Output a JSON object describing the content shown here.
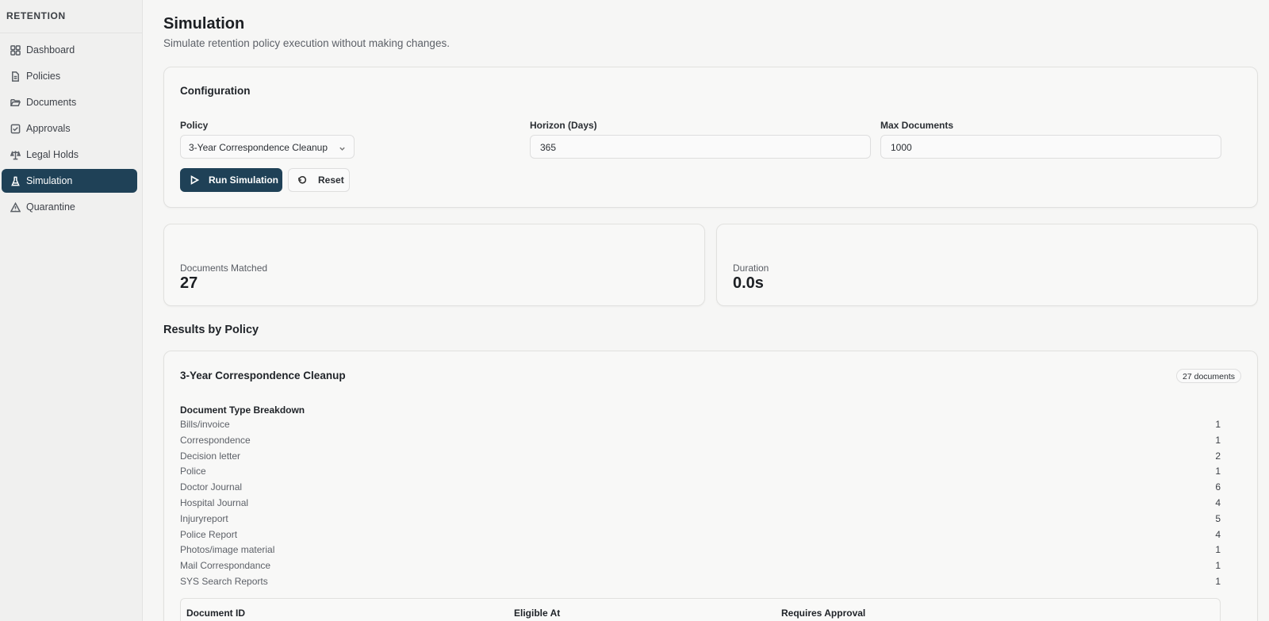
{
  "sidebar": {
    "brand": "RETENTION",
    "items": [
      {
        "label": "Dashboard",
        "icon": "grid-icon"
      },
      {
        "label": "Policies",
        "icon": "file-text-icon"
      },
      {
        "label": "Documents",
        "icon": "folder-open-icon"
      },
      {
        "label": "Approvals",
        "icon": "check-square-icon"
      },
      {
        "label": "Legal Holds",
        "icon": "scale-icon"
      },
      {
        "label": "Simulation",
        "icon": "flask-icon",
        "active": true
      },
      {
        "label": "Quarantine",
        "icon": "alert-triangle-icon"
      }
    ]
  },
  "page": {
    "title": "Simulation",
    "subtitle": "Simulate retention policy execution without making changes."
  },
  "config": {
    "title": "Configuration",
    "policy_label": "Policy",
    "policy_value": "3-Year Correspondence Cleanup",
    "horizon_label": "Horizon (Days)",
    "horizon_value": "365",
    "max_docs_label": "Max Documents",
    "max_docs_value": "1000",
    "run_label": "Run Simulation",
    "reset_label": "Reset"
  },
  "stats": {
    "matched_label": "Documents Matched",
    "matched_value": "27",
    "duration_label": "Duration",
    "duration_value": "0.0s"
  },
  "results": {
    "section_title": "Results by Policy",
    "policy_name": "3-Year Correspondence Cleanup",
    "badge": "27 documents",
    "breakdown_title": "Document Type Breakdown",
    "breakdown": [
      {
        "type": "Bills/invoice",
        "count": "1"
      },
      {
        "type": "Correspondence",
        "count": "1"
      },
      {
        "type": "Decision letter",
        "count": "2"
      },
      {
        "type": "Police",
        "count": "1"
      },
      {
        "type": "Doctor Journal",
        "count": "6"
      },
      {
        "type": "Hospital Journal",
        "count": "4"
      },
      {
        "type": "Injuryreport",
        "count": "5"
      },
      {
        "type": "Police Report",
        "count": "4"
      },
      {
        "type": "Photos/image material",
        "count": "1"
      },
      {
        "type": "Mail Correspondance",
        "count": "1"
      },
      {
        "type": "SYS Search Reports",
        "count": "1"
      }
    ],
    "table_headers": [
      "Document ID",
      "Eligible At",
      "Requires Approval"
    ]
  },
  "colors": {
    "accent": "#1f4157",
    "background": "#f6f6f5"
  }
}
